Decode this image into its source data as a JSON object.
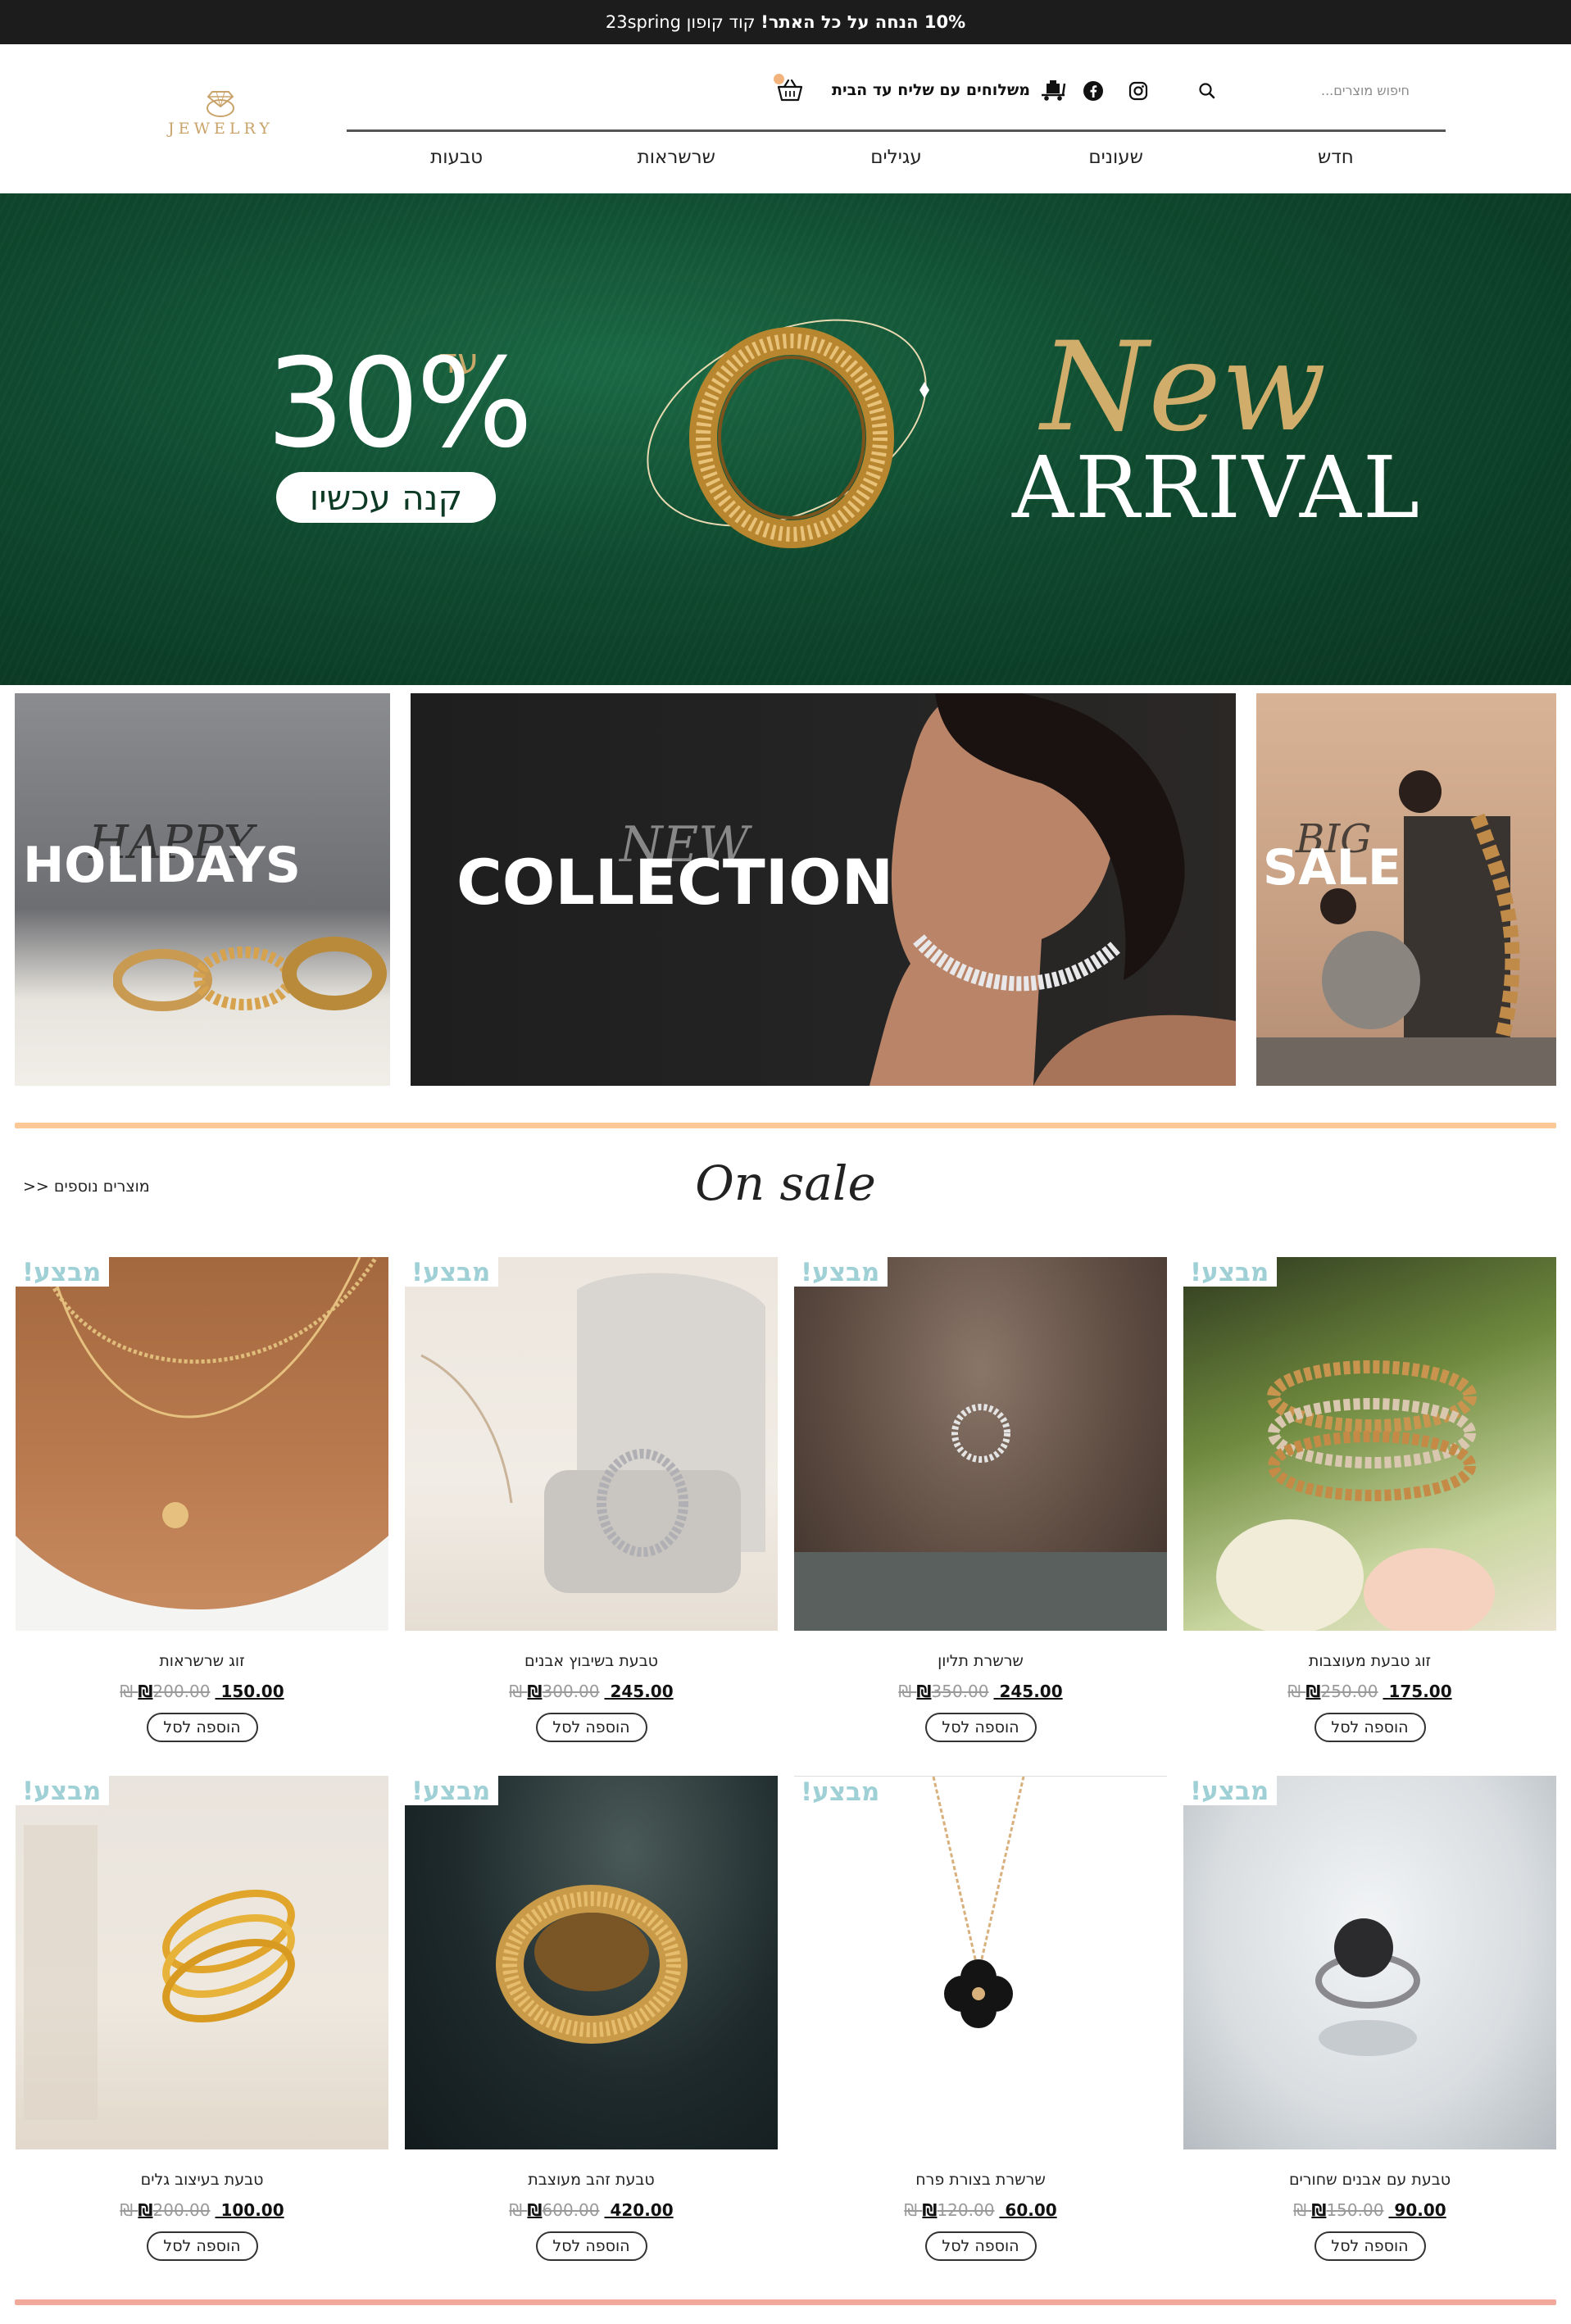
{
  "announcement": {
    "bold": "10% הנחה על כל האתר!",
    "code": "קוד קופון 23spring"
  },
  "header": {
    "logo_text": "JEWELRY",
    "search_placeholder": "חיפוש מוצרים...",
    "shipping_text": "משלוחים עם שליח עד הבית"
  },
  "nav": {
    "items": [
      "חדש",
      "שעונים",
      "עגילים",
      "שרשראות",
      "טבעות"
    ]
  },
  "hero": {
    "upto": "עד",
    "percent": "30%",
    "shop_now": "קנה עכשיו",
    "new_script": "New",
    "arrival": "ARRIVAL"
  },
  "tiles": {
    "holidays": {
      "script": "HAPPY",
      "big": "HOLIDAYS"
    },
    "collection": {
      "script": "NEW",
      "big": "COLLECTION"
    },
    "sale": {
      "script": "BIG",
      "big": "SALE"
    }
  },
  "section": {
    "title": "On sale",
    "more": "מוצרים נוספים <<"
  },
  "products": [
    {
      "tag": "מבצע!",
      "name": "זוג טבעת מעוצבות",
      "price": "175.00 ₪",
      "old_price": "250.00 ₪",
      "add": "הוספה לסל"
    },
    {
      "tag": "מבצע!",
      "name": "שרשרת תליון",
      "price": "245.00 ₪",
      "old_price": "350.00 ₪",
      "add": "הוספה לסל"
    },
    {
      "tag": "מבצע!",
      "name": "טבעת בשיבוץ אבנים",
      "price": "245.00 ₪",
      "old_price": "300.00 ₪",
      "add": "הוספה לסל"
    },
    {
      "tag": "מבצע!",
      "name": "זוג שרשראות",
      "price": "150.00 ₪",
      "old_price": "200.00 ₪",
      "add": "הוספה לסל"
    },
    {
      "tag": "מבצע!",
      "name": "טבעת עם אבנים שחורים",
      "price": "90.00 ₪",
      "old_price": "150.00 ₪",
      "add": "הוספה לסל"
    },
    {
      "tag": "מבצע!",
      "name": "שרשרת בצורת פרח",
      "price": "60.00 ₪",
      "old_price": "120.00 ₪",
      "add": "הוספה לסל"
    },
    {
      "tag": "מבצע!",
      "name": "טבעת זהב מעוצבת",
      "price": "420.00 ₪",
      "old_price": "600.00 ₪",
      "add": "הוספה לסל"
    },
    {
      "tag": "מבצע!",
      "name": "טבעת בעיצוב גלים",
      "price": "100.00 ₪",
      "old_price": "200.00 ₪",
      "add": "הוספה לסל"
    }
  ],
  "colors": {
    "accent_gold": "#c9a36a",
    "sale_tag": "#9fd0d6",
    "hero_green": "#0f4a2f",
    "peach_line": "#fbc896",
    "pink_line": "#f1a99b"
  }
}
